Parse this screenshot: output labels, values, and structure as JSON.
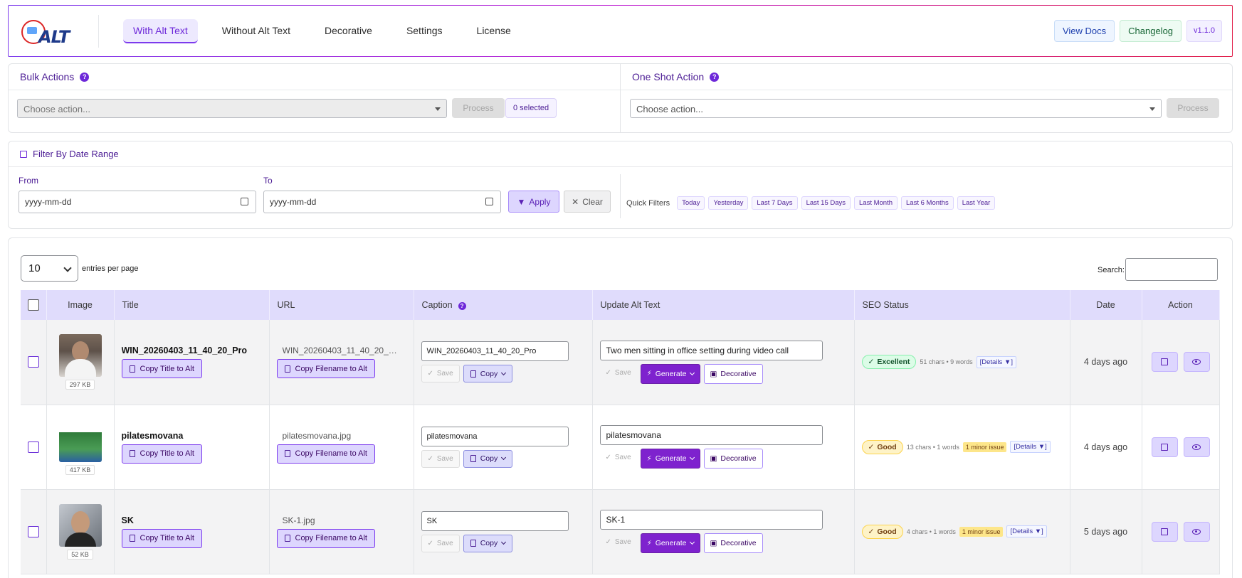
{
  "header": {
    "logo_text": "ALT",
    "tabs": [
      "With Alt Text",
      "Without Alt Text",
      "Decorative",
      "Settings",
      "License"
    ],
    "active_tab": "With Alt Text",
    "view_docs": "View Docs",
    "changelog": "Changelog",
    "version": "v1.1.0"
  },
  "bulk": {
    "title": "Bulk Actions",
    "help": "?",
    "placeholder": "Choose action...",
    "process": "Process",
    "selected": "0 selected"
  },
  "oneshot": {
    "title": "One Shot Action",
    "help": "?",
    "placeholder": "Choose action...",
    "process": "Process"
  },
  "filter": {
    "title": "Filter By Date Range",
    "from_label": "From",
    "to_label": "To",
    "from_placeholder": "yyyy-mm-dd",
    "to_placeholder": "yyyy-mm-dd",
    "apply": "Apply",
    "clear": "Clear",
    "quick_label": "Quick Filters",
    "quick": [
      "Today",
      "Yesterday",
      "Last 7 Days",
      "Last 15 Days",
      "Last Month",
      "Last 6 Months",
      "Last Year"
    ]
  },
  "table": {
    "per_page": "10",
    "per_page_text": "entries per page",
    "search_label": "Search:",
    "columns": {
      "image": "Image",
      "title": "Title",
      "url": "URL",
      "caption": "Caption",
      "update": "Update Alt Text",
      "seo": "SEO Status",
      "date": "Date",
      "action": "Action"
    },
    "copy_title": "Copy Title to Alt",
    "copy_filename": "Copy Filename to Alt",
    "save": "Save",
    "copy": "Copy",
    "generate": "Generate",
    "decorative": "Decorative",
    "rows": [
      {
        "size": "297 KB",
        "title": "WIN_20260403_11_40_20_Pro",
        "url": "WIN_20260403_11_40_20_Pr...",
        "caption": "WIN_20260403_11_40_20_Pro",
        "alt": "Two men sitting in office setting during video call",
        "seo": "Excellent",
        "meta": "51 chars • 9 words",
        "issue": "",
        "details": "[Details ▼]",
        "date": "4 days ago"
      },
      {
        "size": "417 KB",
        "title": "pilatesmovana",
        "url": "pilatesmovana.jpg",
        "caption": "pilatesmovana",
        "alt": "pilatesmovana",
        "seo": "Good",
        "meta": "13 chars • 1 words",
        "issue": "1 minor issue",
        "details": "[Details ▼]",
        "date": "4 days ago"
      },
      {
        "size": "52 KB",
        "title": "SK",
        "url": "SK-1.jpg",
        "caption": "SK",
        "alt": "SK-1",
        "seo": "Good",
        "meta": "4 chars • 1 words",
        "issue": "1 minor issue",
        "details": "[Details ▼]",
        "date": "5 days ago"
      }
    ]
  }
}
